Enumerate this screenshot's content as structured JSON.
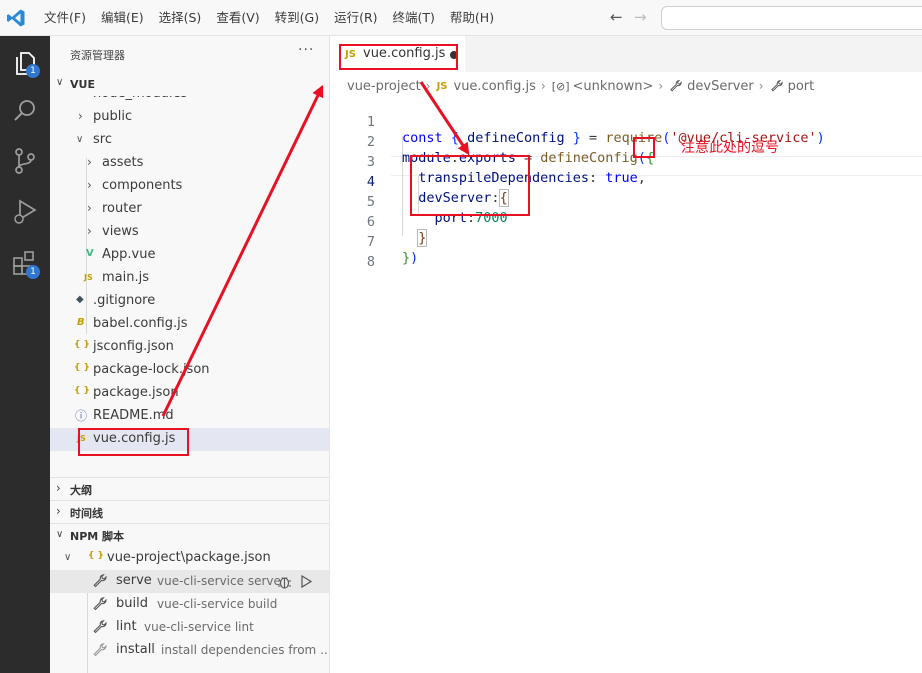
{
  "menu": [
    "文件(F)",
    "编辑(E)",
    "选择(S)",
    "查看(V)",
    "转到(G)",
    "运行(R)",
    "终端(T)",
    "帮助(H)"
  ],
  "nav": {
    "back": "←",
    "forward": "→"
  },
  "activity_bar": {
    "explorer_badge": "1",
    "extensions_badge": "1"
  },
  "sidebar": {
    "title": "资源管理器",
    "more": "···",
    "folder": "VUE",
    "tree": [
      {
        "name": "node_modules",
        "kind": "folder"
      },
      {
        "name": "public",
        "kind": "folder"
      },
      {
        "name": "src",
        "kind": "folder-open"
      },
      {
        "name": "assets",
        "kind": "folder"
      },
      {
        "name": "components",
        "kind": "folder"
      },
      {
        "name": "router",
        "kind": "folder"
      },
      {
        "name": "views",
        "kind": "folder"
      },
      {
        "name": "App.vue",
        "kind": "vue"
      },
      {
        "name": "main.js",
        "kind": "js"
      },
      {
        "name": ".gitignore",
        "kind": "git"
      },
      {
        "name": "babel.config.js",
        "kind": "babel"
      },
      {
        "name": "jsconfig.json",
        "kind": "json"
      },
      {
        "name": "package-lock.json",
        "kind": "json"
      },
      {
        "name": "package.json",
        "kind": "json"
      },
      {
        "name": "README.md",
        "kind": "info"
      },
      {
        "name": "vue.config.js",
        "kind": "js",
        "selected": true
      }
    ],
    "file_icons": {
      "js": "JS",
      "json": "{ }",
      "vue": "V",
      "babel": "B",
      "git": "◆",
      "info": "ⓘ"
    },
    "sections": {
      "outline": "大纲",
      "timeline": "时间线",
      "npm": "NPM 脚本"
    },
    "npm": {
      "package": "vue-project\\package.json",
      "scripts": [
        {
          "name": "serve",
          "command": "vue-cli-service serve"
        },
        {
          "name": "build",
          "command": "vue-cli-service build"
        },
        {
          "name": "lint",
          "command": "vue-cli-service lint"
        },
        {
          "name": "install",
          "command": "install dependencies from ..."
        }
      ]
    }
  },
  "editor": {
    "tab": {
      "icon": "JS",
      "name": "vue.config.js"
    },
    "breadcrumb": {
      "folder": "vue-project",
      "file_icon": "JS",
      "file": "vue.config.js",
      "symbol_icon": "[⊘]",
      "symbol": "<unknown>",
      "prop1": "devServer",
      "prop2": "port"
    },
    "line_numbers": [
      "1",
      "2",
      "3",
      "4",
      "5",
      "6",
      "7",
      "8"
    ],
    "code": {
      "l1": {
        "const": "const",
        "open": "{",
        "name": "defineConfig",
        "close": "}",
        "eq": "=",
        "require": "require",
        "paren_open": "(",
        "str": "'@vue/cli-service'",
        "paren_close": ")"
      },
      "l2": {
        "module": "module",
        "dot": ".",
        "exports": "exports",
        "eq": "=",
        "call": "defineConfig",
        "paren_open": "(",
        "brace_open": "{"
      },
      "l3": {
        "key": "transpileDependencies",
        "colon": ":",
        "value": "true",
        "comma": ","
      },
      "l4": {
        "key": "devServer",
        "colon": ":",
        "brace": "{"
      },
      "l5": {
        "key": "port",
        "colon": ":",
        "value": "7000"
      },
      "l6": {
        "brace": "}"
      },
      "l7": {
        "brace": "}",
        "paren": ")"
      }
    },
    "annotation": "注意此处的逗号"
  },
  "colors": {
    "annotation_red": "#e81123",
    "vue_green": "#41b883",
    "js_yellow": "#c5a000",
    "badge_blue": "#2f77d1"
  }
}
